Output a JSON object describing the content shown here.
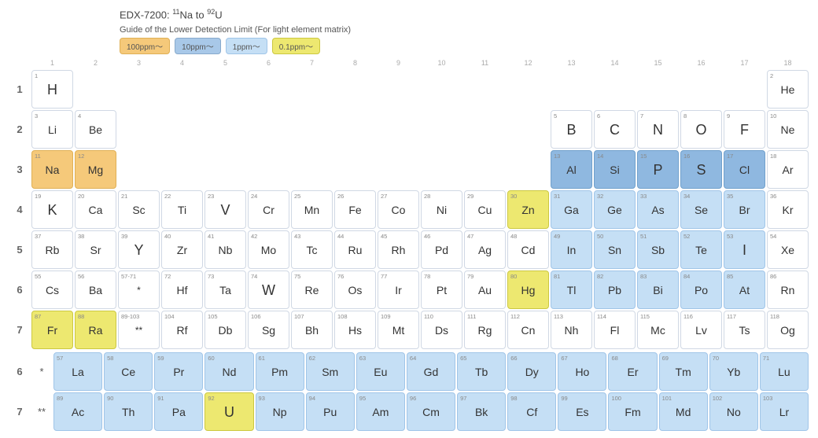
{
  "title": {
    "main": "EDX-7200: ",
    "from": "11",
    "fromEl": "Na",
    "to": "92",
    "toEl": "U"
  },
  "legend": {
    "title": "Guide of the Lower Detection Limit (For light element matrix)",
    "items": [
      {
        "label": "100ppm～",
        "color": "orange"
      },
      {
        "label": "10ppm～",
        "color": "blue1"
      },
      {
        "label": "1ppm～",
        "color": "blue2"
      },
      {
        "label": "0.1ppm～",
        "color": "yellow"
      }
    ]
  },
  "col_numbers": [
    1,
    2,
    3,
    4,
    5,
    6,
    7,
    8,
    9,
    10,
    11,
    12,
    13,
    14,
    15,
    16,
    17,
    18
  ],
  "periods": [
    1,
    2,
    3,
    4,
    5,
    6,
    7
  ],
  "elements": [
    {
      "num": 1,
      "sym": "H",
      "period": 1,
      "group": 1,
      "color": "white"
    },
    {
      "num": 2,
      "sym": "He",
      "period": 1,
      "group": 18,
      "color": "white"
    },
    {
      "num": 3,
      "sym": "Li",
      "period": 2,
      "group": 1,
      "color": "white"
    },
    {
      "num": 4,
      "sym": "Be",
      "period": 2,
      "group": 2,
      "color": "white"
    },
    {
      "num": 5,
      "sym": "B",
      "period": 2,
      "group": 13,
      "color": "white"
    },
    {
      "num": 6,
      "sym": "C",
      "period": 2,
      "group": 14,
      "color": "white"
    },
    {
      "num": 7,
      "sym": "N",
      "period": 2,
      "group": 15,
      "color": "white"
    },
    {
      "num": 8,
      "sym": "O",
      "period": 2,
      "group": 16,
      "color": "white"
    },
    {
      "num": 9,
      "sym": "F",
      "period": 2,
      "group": 17,
      "color": "white"
    },
    {
      "num": 10,
      "sym": "Ne",
      "period": 2,
      "group": 18,
      "color": "white"
    },
    {
      "num": 11,
      "sym": "Na",
      "period": 3,
      "group": 1,
      "color": "orange"
    },
    {
      "num": 12,
      "sym": "Mg",
      "period": 3,
      "group": 2,
      "color": "orange"
    },
    {
      "num": 13,
      "sym": "Al",
      "period": 3,
      "group": 13,
      "color": "bblue"
    },
    {
      "num": 14,
      "sym": "Si",
      "period": 3,
      "group": 14,
      "color": "bblue"
    },
    {
      "num": 15,
      "sym": "P",
      "period": 3,
      "group": 15,
      "color": "bblue"
    },
    {
      "num": 16,
      "sym": "S",
      "period": 3,
      "group": 16,
      "color": "bblue"
    },
    {
      "num": 17,
      "sym": "Cl",
      "period": 3,
      "group": 17,
      "color": "bblue"
    },
    {
      "num": 18,
      "sym": "Ar",
      "period": 3,
      "group": 18,
      "color": "white"
    },
    {
      "num": 19,
      "sym": "K",
      "period": 4,
      "group": 1,
      "color": "white"
    },
    {
      "num": 20,
      "sym": "Ca",
      "period": 4,
      "group": 2,
      "color": "white"
    },
    {
      "num": 21,
      "sym": "Sc",
      "period": 4,
      "group": 3,
      "color": "white"
    },
    {
      "num": 22,
      "sym": "Ti",
      "period": 4,
      "group": 4,
      "color": "white"
    },
    {
      "num": 23,
      "sym": "V",
      "period": 4,
      "group": 5,
      "color": "white"
    },
    {
      "num": 24,
      "sym": "Cr",
      "period": 4,
      "group": 6,
      "color": "white"
    },
    {
      "num": 25,
      "sym": "Mn",
      "period": 4,
      "group": 7,
      "color": "white"
    },
    {
      "num": 26,
      "sym": "Fe",
      "period": 4,
      "group": 8,
      "color": "white"
    },
    {
      "num": 27,
      "sym": "Co",
      "period": 4,
      "group": 9,
      "color": "white"
    },
    {
      "num": 28,
      "sym": "Ni",
      "period": 4,
      "group": 10,
      "color": "white"
    },
    {
      "num": 29,
      "sym": "Cu",
      "period": 4,
      "group": 11,
      "color": "white"
    },
    {
      "num": 30,
      "sym": "Zn",
      "period": 4,
      "group": 12,
      "color": "yellow"
    },
    {
      "num": 31,
      "sym": "Ga",
      "period": 4,
      "group": 13,
      "color": "lblue"
    },
    {
      "num": 32,
      "sym": "Ge",
      "period": 4,
      "group": 14,
      "color": "lblue"
    },
    {
      "num": 33,
      "sym": "As",
      "period": 4,
      "group": 15,
      "color": "lblue"
    },
    {
      "num": 34,
      "sym": "Se",
      "period": 4,
      "group": 16,
      "color": "lblue"
    },
    {
      "num": 35,
      "sym": "Br",
      "period": 4,
      "group": 17,
      "color": "lblue"
    },
    {
      "num": 36,
      "sym": "Kr",
      "period": 4,
      "group": 18,
      "color": "white"
    },
    {
      "num": 37,
      "sym": "Rb",
      "period": 5,
      "group": 1,
      "color": "white"
    },
    {
      "num": 38,
      "sym": "Sr",
      "period": 5,
      "group": 2,
      "color": "white"
    },
    {
      "num": 39,
      "sym": "Y",
      "period": 5,
      "group": 3,
      "color": "white"
    },
    {
      "num": 40,
      "sym": "Zr",
      "period": 5,
      "group": 4,
      "color": "white"
    },
    {
      "num": 41,
      "sym": "Nb",
      "period": 5,
      "group": 5,
      "color": "white"
    },
    {
      "num": 42,
      "sym": "Mo",
      "period": 5,
      "group": 6,
      "color": "white"
    },
    {
      "num": 43,
      "sym": "Tc",
      "period": 5,
      "group": 7,
      "color": "white"
    },
    {
      "num": 44,
      "sym": "Ru",
      "period": 5,
      "group": 8,
      "color": "white"
    },
    {
      "num": 45,
      "sym": "Rh",
      "period": 5,
      "group": 9,
      "color": "white"
    },
    {
      "num": 46,
      "sym": "Pd",
      "period": 5,
      "group": 10,
      "color": "white"
    },
    {
      "num": 47,
      "sym": "Ag",
      "period": 5,
      "group": 11,
      "color": "white"
    },
    {
      "num": 48,
      "sym": "Cd",
      "period": 5,
      "group": 12,
      "color": "white"
    },
    {
      "num": 49,
      "sym": "In",
      "period": 5,
      "group": 13,
      "color": "lblue"
    },
    {
      "num": 50,
      "sym": "Sn",
      "period": 5,
      "group": 14,
      "color": "lblue"
    },
    {
      "num": 51,
      "sym": "Sb",
      "period": 5,
      "group": 15,
      "color": "lblue"
    },
    {
      "num": 52,
      "sym": "Te",
      "period": 5,
      "group": 16,
      "color": "lblue"
    },
    {
      "num": 53,
      "sym": "I",
      "period": 5,
      "group": 17,
      "color": "lblue"
    },
    {
      "num": 54,
      "sym": "Xe",
      "period": 5,
      "group": 18,
      "color": "white"
    },
    {
      "num": 55,
      "sym": "Cs",
      "period": 6,
      "group": 1,
      "color": "white"
    },
    {
      "num": 56,
      "sym": "Ba",
      "period": 6,
      "group": 2,
      "color": "white"
    },
    {
      "num": 72,
      "sym": "Hf",
      "period": 6,
      "group": 4,
      "color": "white"
    },
    {
      "num": 73,
      "sym": "Ta",
      "period": 6,
      "group": 5,
      "color": "white"
    },
    {
      "num": 74,
      "sym": "W",
      "period": 6,
      "group": 6,
      "color": "white"
    },
    {
      "num": 75,
      "sym": "Re",
      "period": 6,
      "group": 7,
      "color": "white"
    },
    {
      "num": 76,
      "sym": "Os",
      "period": 6,
      "group": 8,
      "color": "white"
    },
    {
      "num": 77,
      "sym": "Ir",
      "period": 6,
      "group": 9,
      "color": "white"
    },
    {
      "num": 78,
      "sym": "Pt",
      "period": 6,
      "group": 10,
      "color": "white"
    },
    {
      "num": 79,
      "sym": "Au",
      "period": 6,
      "group": 11,
      "color": "white"
    },
    {
      "num": 80,
      "sym": "Hg",
      "period": 6,
      "group": 12,
      "color": "yellow"
    },
    {
      "num": 81,
      "sym": "Tl",
      "period": 6,
      "group": 13,
      "color": "lblue"
    },
    {
      "num": 82,
      "sym": "Pb",
      "period": 6,
      "group": 14,
      "color": "lblue"
    },
    {
      "num": 83,
      "sym": "Bi",
      "period": 6,
      "group": 15,
      "color": "lblue"
    },
    {
      "num": 84,
      "sym": "Po",
      "period": 6,
      "group": 16,
      "color": "lblue"
    },
    {
      "num": 85,
      "sym": "At",
      "period": 6,
      "group": 17,
      "color": "lblue"
    },
    {
      "num": 86,
      "sym": "Rn",
      "period": 6,
      "group": 18,
      "color": "white"
    },
    {
      "num": 87,
      "sym": "Fr",
      "period": 7,
      "group": 1,
      "color": "yellow"
    },
    {
      "num": 88,
      "sym": "Ra",
      "period": 7,
      "group": 2,
      "color": "yellow"
    },
    {
      "num": 104,
      "sym": "Rf",
      "period": 7,
      "group": 4,
      "color": "white"
    },
    {
      "num": 105,
      "sym": "Db",
      "period": 7,
      "group": 5,
      "color": "white"
    },
    {
      "num": 106,
      "sym": "Sg",
      "period": 7,
      "group": 6,
      "color": "white"
    },
    {
      "num": 107,
      "sym": "Bh",
      "period": 7,
      "group": 7,
      "color": "white"
    },
    {
      "num": 108,
      "sym": "Hs",
      "period": 7,
      "group": 8,
      "color": "white"
    },
    {
      "num": 109,
      "sym": "Mt",
      "period": 7,
      "group": 9,
      "color": "white"
    },
    {
      "num": 110,
      "sym": "Ds",
      "period": 7,
      "group": 10,
      "color": "white"
    },
    {
      "num": 111,
      "sym": "Rg",
      "period": 7,
      "group": 11,
      "color": "white"
    },
    {
      "num": 112,
      "sym": "Cn",
      "period": 7,
      "group": 12,
      "color": "white"
    },
    {
      "num": 113,
      "sym": "Nh",
      "period": 7,
      "group": 13,
      "color": "white"
    },
    {
      "num": 114,
      "sym": "Fl",
      "period": 7,
      "group": 14,
      "color": "white"
    },
    {
      "num": 115,
      "sym": "Mc",
      "period": 7,
      "group": 15,
      "color": "white"
    },
    {
      "num": 116,
      "sym": "Lv",
      "period": 7,
      "group": 16,
      "color": "white"
    },
    {
      "num": 117,
      "sym": "Ts",
      "period": 7,
      "group": 17,
      "color": "white"
    },
    {
      "num": 118,
      "sym": "Og",
      "period": 7,
      "group": 18,
      "color": "white"
    },
    {
      "num": 57,
      "sym": "La",
      "period": 6,
      "group": 3,
      "color": "lblue",
      "lanthanide": true,
      "lIdx": 0
    },
    {
      "num": 58,
      "sym": "Ce",
      "period": 6,
      "group": 4,
      "color": "lblue",
      "lanthanide": true,
      "lIdx": 1
    },
    {
      "num": 59,
      "sym": "Pr",
      "period": 6,
      "group": 5,
      "color": "lblue",
      "lanthanide": true,
      "lIdx": 2
    },
    {
      "num": 60,
      "sym": "Nd",
      "period": 6,
      "group": 6,
      "color": "lblue",
      "lanthanide": true,
      "lIdx": 3
    },
    {
      "num": 61,
      "sym": "Pm",
      "period": 6,
      "group": 7,
      "color": "lblue",
      "lanthanide": true,
      "lIdx": 4
    },
    {
      "num": 62,
      "sym": "Sm",
      "period": 6,
      "group": 8,
      "color": "lblue",
      "lanthanide": true,
      "lIdx": 5
    },
    {
      "num": 63,
      "sym": "Eu",
      "period": 6,
      "group": 9,
      "color": "lblue",
      "lanthanide": true,
      "lIdx": 6
    },
    {
      "num": 64,
      "sym": "Gd",
      "period": 6,
      "group": 10,
      "color": "lblue",
      "lanthanide": true,
      "lIdx": 7
    },
    {
      "num": 65,
      "sym": "Tb",
      "period": 6,
      "group": 11,
      "color": "lblue",
      "lanthanide": true,
      "lIdx": 8
    },
    {
      "num": 66,
      "sym": "Dy",
      "period": 6,
      "group": 12,
      "color": "lblue",
      "lanthanide": true,
      "lIdx": 9
    },
    {
      "num": 67,
      "sym": "Ho",
      "period": 6,
      "group": 13,
      "color": "lblue",
      "lanthanide": true,
      "lIdx": 10
    },
    {
      "num": 68,
      "sym": "Er",
      "period": 6,
      "group": 14,
      "color": "lblue",
      "lanthanide": true,
      "lIdx": 11
    },
    {
      "num": 69,
      "sym": "Tm",
      "period": 6,
      "group": 15,
      "color": "lblue",
      "lanthanide": true,
      "lIdx": 12
    },
    {
      "num": 70,
      "sym": "Yb",
      "period": 6,
      "group": 16,
      "color": "lblue",
      "lanthanide": true,
      "lIdx": 13
    },
    {
      "num": 71,
      "sym": "Lu",
      "period": 6,
      "group": 17,
      "color": "lblue",
      "lanthanide": true,
      "lIdx": 14
    },
    {
      "num": 89,
      "sym": "Ac",
      "period": 7,
      "group": 3,
      "color": "lblue",
      "actinide": true,
      "aIdx": 0
    },
    {
      "num": 90,
      "sym": "Th",
      "period": 7,
      "group": 4,
      "color": "lblue",
      "actinide": true,
      "aIdx": 1
    },
    {
      "num": 91,
      "sym": "Pa",
      "period": 7,
      "group": 5,
      "color": "lblue",
      "actinide": true,
      "aIdx": 2
    },
    {
      "num": 92,
      "sym": "U",
      "period": 7,
      "group": 6,
      "color": "yellow",
      "actinide": true,
      "aIdx": 3
    },
    {
      "num": 93,
      "sym": "Np",
      "period": 7,
      "group": 7,
      "color": "lblue",
      "actinide": true,
      "aIdx": 4
    },
    {
      "num": 94,
      "sym": "Pu",
      "period": 7,
      "group": 8,
      "color": "lblue",
      "actinide": true,
      "aIdx": 5
    },
    {
      "num": 95,
      "sym": "Am",
      "period": 7,
      "group": 9,
      "color": "lblue",
      "actinide": true,
      "aIdx": 6
    },
    {
      "num": 96,
      "sym": "Cm",
      "period": 7,
      "group": 10,
      "color": "lblue",
      "actinide": true,
      "aIdx": 7
    },
    {
      "num": 97,
      "sym": "Bk",
      "period": 7,
      "group": 11,
      "color": "lblue",
      "actinide": true,
      "aIdx": 8
    },
    {
      "num": 98,
      "sym": "Cf",
      "period": 7,
      "group": 12,
      "color": "lblue",
      "actinide": true,
      "aIdx": 9
    },
    {
      "num": 99,
      "sym": "Es",
      "period": 7,
      "group": 13,
      "color": "lblue",
      "actinide": true,
      "aIdx": 10
    },
    {
      "num": 100,
      "sym": "Fm",
      "period": 7,
      "group": 14,
      "color": "lblue",
      "actinide": true,
      "aIdx": 11
    },
    {
      "num": 101,
      "sym": "Md",
      "period": 7,
      "group": 15,
      "color": "lblue",
      "actinide": true,
      "aIdx": 12
    },
    {
      "num": 102,
      "sym": "No",
      "period": 7,
      "group": 16,
      "color": "lblue",
      "actinide": true,
      "aIdx": 13
    },
    {
      "num": 103,
      "sym": "Lr",
      "period": 7,
      "group": 17,
      "color": "lblue",
      "actinide": true,
      "aIdx": 14
    }
  ],
  "period6_star": "57-71",
  "period7_star": "89-103",
  "period6_star_sym": "*",
  "period7_star_sym": "**",
  "bottom_row6_label": "6",
  "bottom_row7_label": "7",
  "bottom_star6": "*",
  "bottom_star7": "**"
}
